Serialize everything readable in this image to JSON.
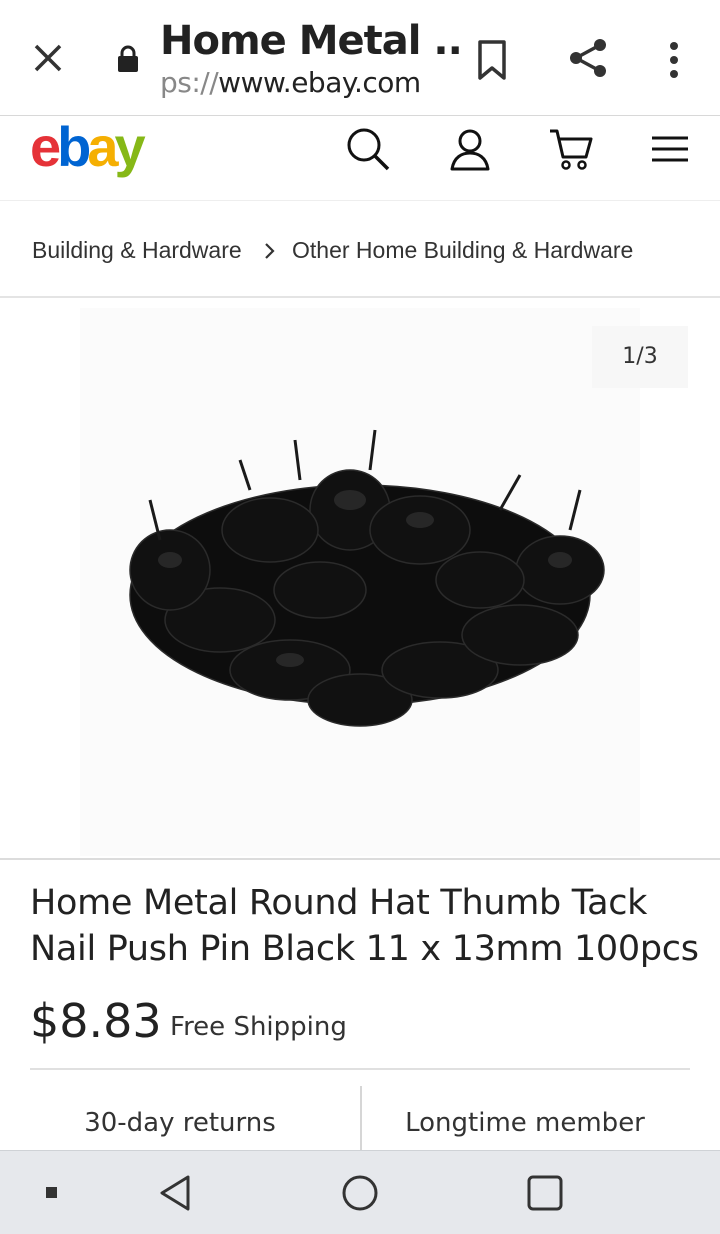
{
  "browser": {
    "title": "Home Metal ...",
    "url_scheme": "ps://",
    "url_host": "www.ebay.com"
  },
  "header": {
    "logo": [
      "e",
      "b",
      "a",
      "y"
    ],
    "icons": [
      "search-icon",
      "account-icon",
      "cart-icon",
      "menu-icon"
    ]
  },
  "breadcrumb": {
    "items": [
      "Building & Hardware",
      "Other Home Building & Hardware"
    ]
  },
  "gallery": {
    "counter": "1/3"
  },
  "product": {
    "title": "Home Metal Round Hat Thumb Tack Nail Push Pin Black 11 x 13mm 100pcs",
    "price": "$8.83",
    "shipping": "Free Shipping"
  },
  "badges": {
    "left": "30-day returns",
    "right": "Longtime member"
  },
  "colors": {
    "ebay_e": "#e53238",
    "ebay_b": "#0064d2",
    "ebay_a": "#f5af02",
    "ebay_y": "#86b817"
  }
}
